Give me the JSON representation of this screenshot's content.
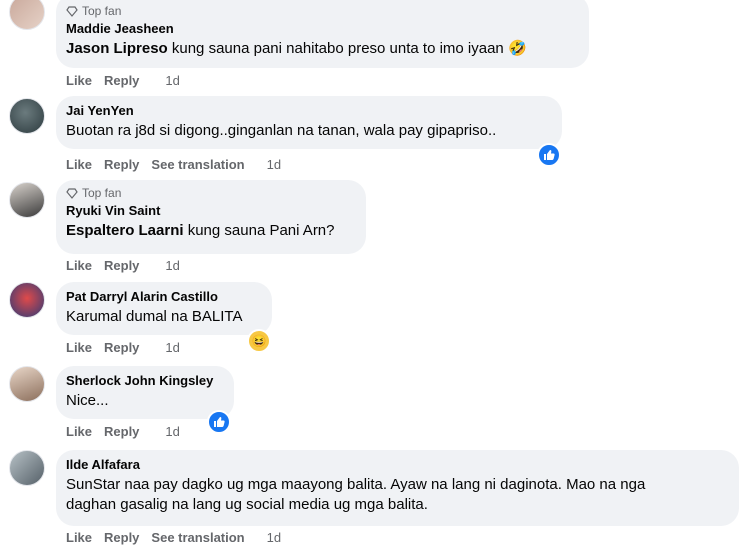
{
  "comments": [
    {
      "top_fan": "Top fan",
      "name": "Maddie Jeasheen",
      "mention": "Jason Lipreso",
      "text": "kung sauna pani nahitabo preso unta to imo iyaan",
      "actions": {
        "like": "Like",
        "reply": "Reply",
        "time": "1d"
      },
      "reaction": "rofl-emoji"
    },
    {
      "name": "Jai YenYen",
      "text": "Buotan ra j8d si digong..ginganlan na tanan, wala pay gipapriso..",
      "actions": {
        "like": "Like",
        "reply": "Reply",
        "translate": "See translation",
        "time": "1d"
      },
      "reaction": "like-icon"
    },
    {
      "top_fan": "Top fan",
      "name": "Ryuki Vin Saint",
      "mention": "Espaltero Laarni",
      "text": "kung sauna Pani Arn?",
      "actions": {
        "like": "Like",
        "reply": "Reply",
        "time": "1d"
      }
    },
    {
      "name": "Pat Darryl Alarin Castillo",
      "text": "Karumal dumal na BALITA",
      "actions": {
        "like": "Like",
        "reply": "Reply",
        "time": "1d"
      },
      "reaction": "haha-emoji"
    },
    {
      "name": "Sherlock John Kingsley",
      "text": "Nice...",
      "actions": {
        "like": "Like",
        "reply": "Reply",
        "time": "1d"
      },
      "reaction": "like-icon"
    },
    {
      "name": "Ilde Alfafara",
      "text_line1": "SunStar naa pay dagko ug mga maayong balita. Ayaw na lang ni daginota. Mao na nga",
      "text_line2": "daghan gasalig na lang ug social media ug mga balita.",
      "actions": {
        "like": "Like",
        "reply": "Reply",
        "translate": "See translation",
        "time": "1d"
      }
    }
  ],
  "colors": {
    "bubble": "#f0f2f5",
    "meta": "#65676b",
    "like_blue": "#1877f2"
  }
}
